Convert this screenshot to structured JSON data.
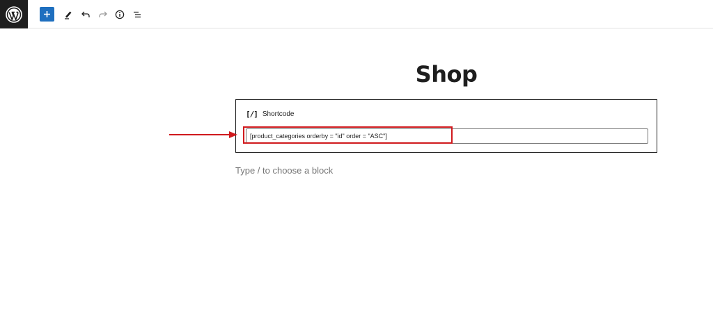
{
  "toolbar": {
    "logo_icon": "wordpress-icon",
    "add_icon": "plus-icon",
    "tools_icon": "pencil-icon",
    "undo_icon": "undo-icon",
    "redo_icon": "redo-icon",
    "info_icon": "info-icon",
    "outline_icon": "list-view-icon",
    "accent_color": "#1e6fbf"
  },
  "page": {
    "title": "Shop"
  },
  "shortcode_block": {
    "icon_text": "[/]",
    "label": "Shortcode",
    "value": "[product_categories orderby = \"id\" order = \"ASC\"]"
  },
  "annotation": {
    "color": "#d0191d"
  },
  "editor": {
    "placeholder": "Type / to choose a block"
  }
}
